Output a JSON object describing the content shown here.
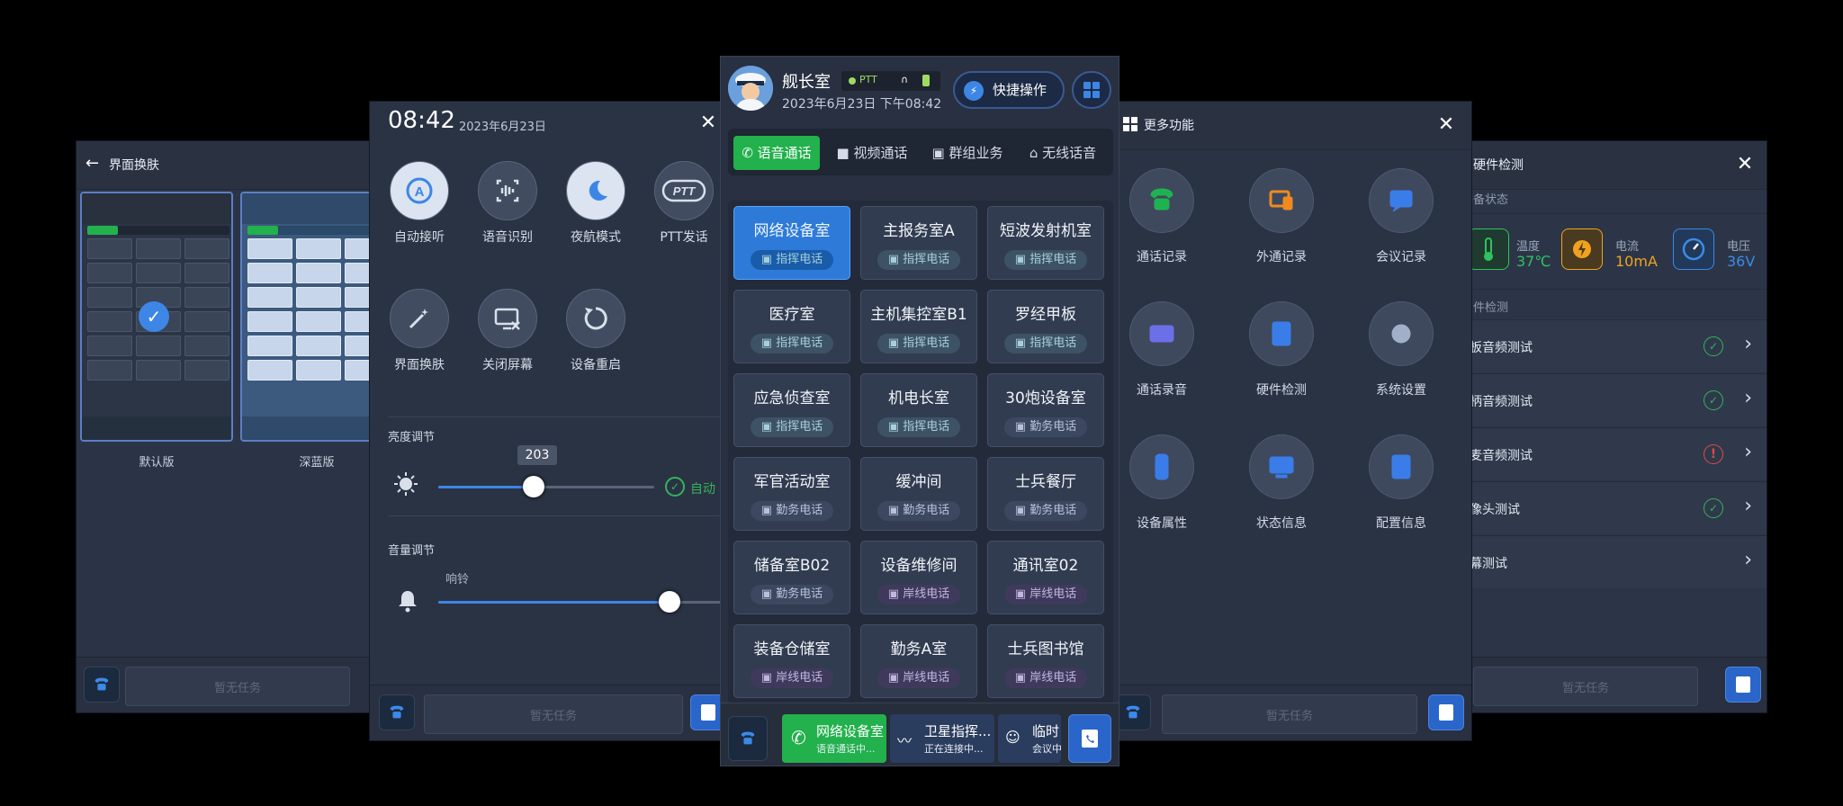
{
  "skin": {
    "title": "界面换肤",
    "default_label": "默认版",
    "deepblue_label": "深蓝版",
    "no_task": "暂无任务"
  },
  "quick_panel": {
    "time": "08:42",
    "date": "2023年6月23日",
    "buttons": [
      {
        "label": "自动接听",
        "icon": "auto-answer-icon"
      },
      {
        "label": "语音识别",
        "icon": "voice-recognition-icon"
      },
      {
        "label": "夜航模式",
        "icon": "night-mode-icon"
      },
      {
        "label": "PTT发话",
        "icon": "ptt-icon"
      },
      {
        "label": "界面换肤",
        "icon": "skin-icon"
      },
      {
        "label": "关闭屏幕",
        "icon": "screen-off-icon"
      },
      {
        "label": "设备重启",
        "icon": "restart-icon"
      }
    ],
    "brightness_title": "亮度调节",
    "brightness_value": "203",
    "brightness_level": 203,
    "brightness_fraction": 0.44,
    "auto_label": "自动",
    "volume_title": "音量调节",
    "ringtone_label": "响铃",
    "volume_fraction": 0.78,
    "no_task": "暂无任务"
  },
  "main": {
    "user": "舰长室",
    "ptt": "PTT",
    "datetime": "2023年6月23日 下午08:42",
    "quick_label": "快捷操作",
    "tabs": [
      "语音通话",
      "视频通话",
      "群组业务",
      "无线话音"
    ],
    "rooms": [
      {
        "name": "网络设备室",
        "type": "指挥电话",
        "kind": "call"
      },
      {
        "name": "主报务室A",
        "type": "指挥电话",
        "kind": "call"
      },
      {
        "name": "短波发射机室",
        "type": "指挥电话",
        "kind": "call"
      },
      {
        "name": "医疗室",
        "type": "指挥电话",
        "kind": "call"
      },
      {
        "name": "主机集控室B1",
        "type": "指挥电话",
        "kind": "call"
      },
      {
        "name": "罗经甲板",
        "type": "指挥电话",
        "kind": "call"
      },
      {
        "name": "应急侦查室",
        "type": "指挥电话",
        "kind": "call"
      },
      {
        "name": "机电长室",
        "type": "指挥电话",
        "kind": "call"
      },
      {
        "name": "30炮设备室",
        "type": "勤务电话",
        "kind": "duty"
      },
      {
        "name": "军官活动室",
        "type": "勤务电话",
        "kind": "duty"
      },
      {
        "name": "缓冲间",
        "type": "勤务电话",
        "kind": "duty"
      },
      {
        "name": "士兵餐厅",
        "type": "勤务电话",
        "kind": "duty"
      },
      {
        "name": "储备室B02",
        "type": "勤务电话",
        "kind": "duty"
      },
      {
        "name": "设备维修间",
        "type": "岸线电话",
        "kind": "shore"
      },
      {
        "name": "通讯室02",
        "type": "岸线电话",
        "kind": "shore"
      },
      {
        "name": "装备仓储室",
        "type": "岸线电话",
        "kind": "shore"
      },
      {
        "name": "勤务A室",
        "type": "岸线电话",
        "kind": "shore"
      },
      {
        "name": "士兵图书馆",
        "type": "岸线电话",
        "kind": "shore"
      }
    ],
    "bottom": [
      {
        "title": "网络设备室",
        "sub": "语音通话中..."
      },
      {
        "title": "卫星指挥...",
        "sub": "正在连接中..."
      },
      {
        "title": "临时",
        "sub": "会议中"
      }
    ]
  },
  "more": {
    "title": "更多功能",
    "items": [
      {
        "label": "通话记录",
        "icon": "call-log-icon",
        "color": "#1fb350"
      },
      {
        "label": "外通记录",
        "icon": "external-call-icon",
        "color": "#f08a1e"
      },
      {
        "label": "会议记录",
        "icon": "meeting-log-icon",
        "color": "#3b7de8"
      },
      {
        "label": "通话录音",
        "icon": "call-recording-icon",
        "color": "#6b6fe8"
      },
      {
        "label": "硬件检测",
        "icon": "hardware-check-icon",
        "color": "#3b7de8"
      },
      {
        "label": "系统设置",
        "icon": "settings-icon",
        "color": "#9fb0c8"
      },
      {
        "label": "设备属性",
        "icon": "device-property-icon",
        "color": "#3b7de8"
      },
      {
        "label": "状态信息",
        "icon": "status-info-icon",
        "color": "#3b7de8"
      },
      {
        "label": "配置信息",
        "icon": "config-info-icon",
        "color": "#3b7de8"
      }
    ],
    "no_task": "暂无任务"
  },
  "hardware": {
    "title": "硬件检测",
    "status_section": "备状态",
    "stats": [
      {
        "label": "温度",
        "value": "37℃",
        "color": "#2ec35f"
      },
      {
        "label": "电流",
        "value": "10mA",
        "color": "#f0a21e"
      },
      {
        "label": "电压",
        "value": "36V",
        "color": "#3b8ae8"
      }
    ],
    "check_section": "件检测",
    "tests": [
      {
        "name": "板音频测试",
        "result": "ok"
      },
      {
        "name": "柄音频测试",
        "result": "ok"
      },
      {
        "name": "麦音频测试",
        "result": "fail"
      },
      {
        "name": "像头测试",
        "result": "ok"
      },
      {
        "name": "幕测试",
        "result": "none"
      }
    ],
    "no_task": "暂无任务"
  }
}
